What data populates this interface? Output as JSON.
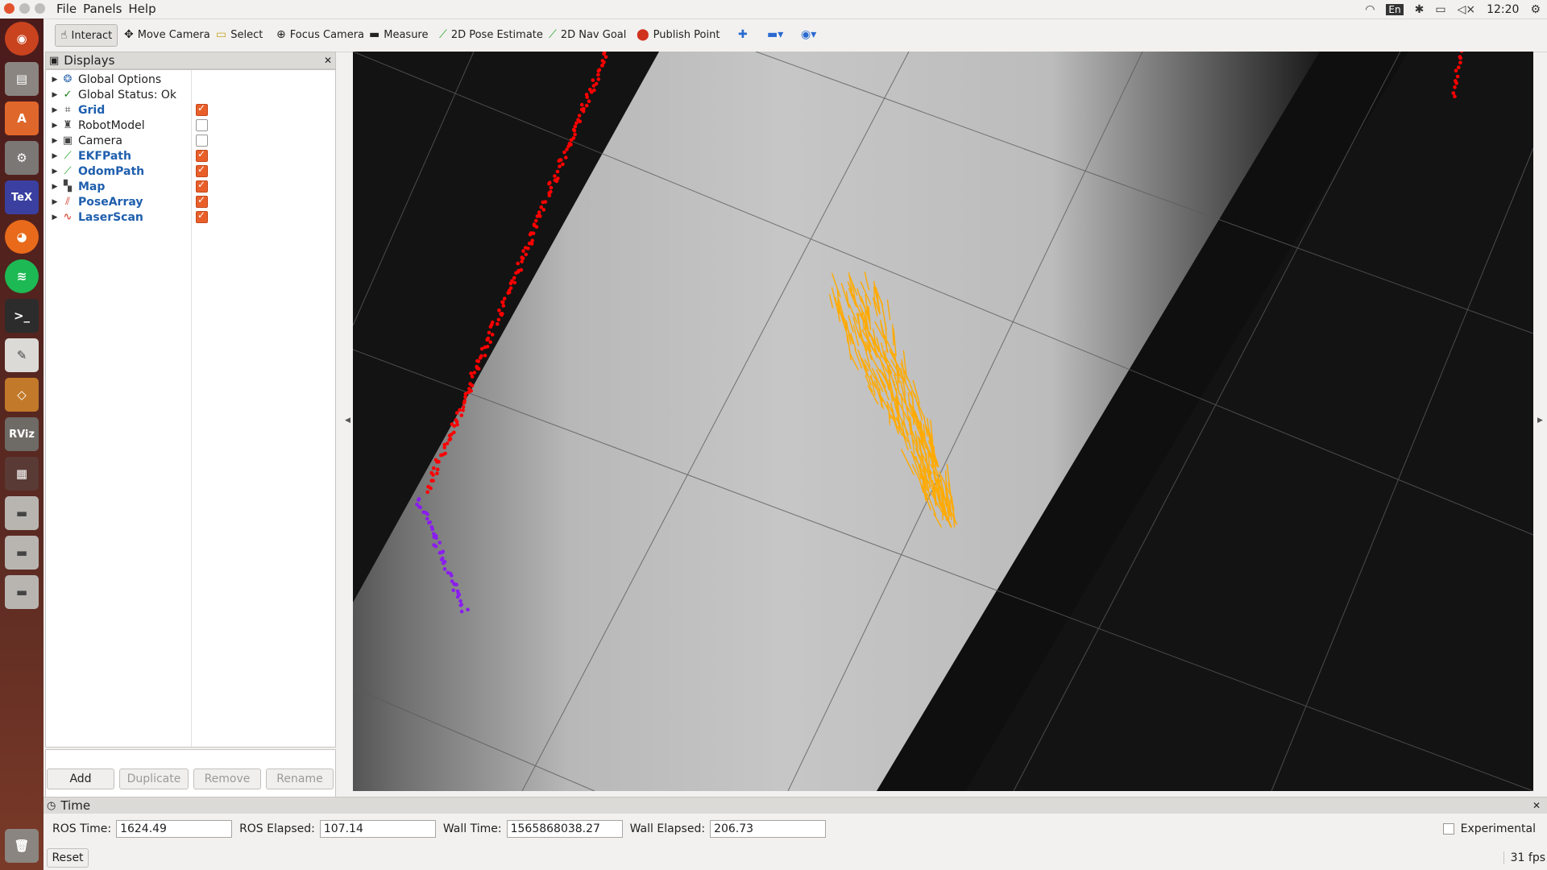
{
  "menu": {
    "file": "File",
    "panels": "Panels",
    "help": "Help"
  },
  "tray": {
    "time": "12:20",
    "keyboard": "En"
  },
  "toolbar": {
    "interact": "Interact",
    "move_camera": "Move Camera",
    "select": "Select",
    "focus_camera": "Focus Camera",
    "measure": "Measure",
    "pose_estimate": "2D Pose Estimate",
    "nav_goal": "2D Nav Goal",
    "publish_point": "Publish Point"
  },
  "displays": {
    "title": "Displays",
    "items": [
      {
        "label": "Global Options"
      },
      {
        "label": "Global Status: Ok"
      },
      {
        "label": "Grid",
        "checked": true
      },
      {
        "label": "RobotModel",
        "checked": false
      },
      {
        "label": "Camera",
        "checked": false
      },
      {
        "label": "EKFPath",
        "checked": true
      },
      {
        "label": "OdomPath",
        "checked": true
      },
      {
        "label": "Map",
        "checked": true
      },
      {
        "label": "PoseArray",
        "checked": true
      },
      {
        "label": "LaserScan",
        "checked": true
      }
    ],
    "buttons": {
      "add": "Add",
      "duplicate": "Duplicate",
      "remove": "Remove",
      "rename": "Rename"
    }
  },
  "launcher": {
    "rviz": "RViz"
  },
  "time_panel": {
    "title": "Time",
    "ros_time_label": "ROS Time:",
    "ros_time": "1624.49",
    "ros_elapsed_label": "ROS Elapsed:",
    "ros_elapsed": "107.14",
    "wall_time_label": "Wall Time:",
    "wall_time": "1565868038.27",
    "wall_elapsed_label": "Wall Elapsed:",
    "wall_elapsed": "206.73",
    "experimental": "Experimental"
  },
  "status": {
    "reset": "Reset",
    "fps": "31 fps"
  },
  "colors": {
    "accent": "#e95f2a",
    "laser_red": "#ff0000",
    "laser_purple": "#8a1cf0",
    "particles": "#ffaa00"
  }
}
